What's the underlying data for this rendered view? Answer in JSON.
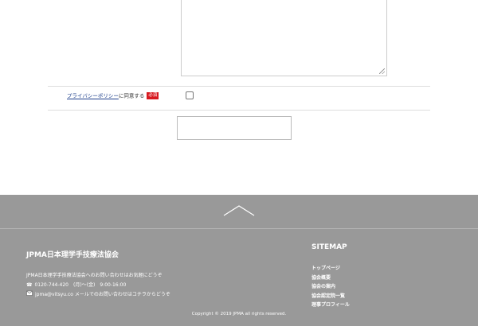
{
  "form": {
    "message_value": "",
    "privacy": {
      "link_text": "プライバシーポリシー",
      "suffix": "に同意する",
      "required_badge": "必須"
    },
    "submit_label": ""
  },
  "footer": {
    "org_name": "JPMA日本理学手技療法協会",
    "contact": {
      "intro": "JPMA日本理学手技療法協会へのお問い合わせはお気軽にどうぞ",
      "phone": "0120-744-420　(月)〜(金)　9:00-16:00",
      "email": "jpma@vitsyu.co メールでのお問い合わせはコチラからどうぞ"
    },
    "sitemap": {
      "title": "SITEMAP",
      "items": [
        "トップページ",
        "協会概要",
        "協会の案内",
        "協会認定院一覧",
        "理事プロフィール"
      ]
    },
    "copyright": "Copyright © 2019 JPMA all rights reserved."
  },
  "icons": {
    "pagetop": "chevron-up-icon",
    "phone": "phone-icon",
    "mail": "mail-icon"
  },
  "colors": {
    "footer_bg": "#999999",
    "required_badge": "#d7191f",
    "link": "#1a3c8a"
  }
}
